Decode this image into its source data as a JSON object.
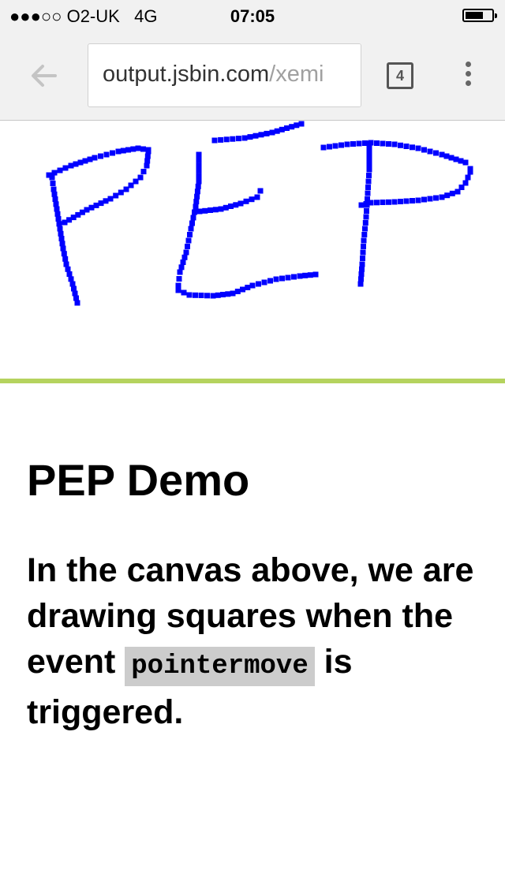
{
  "status_bar": {
    "signal": "●●●○○",
    "carrier": "O2-UK",
    "network": "4G",
    "time": "07:05"
  },
  "browser": {
    "url_host": "output.jsbin.com",
    "url_path": "/xemi",
    "tab_count": "4"
  },
  "page": {
    "heading": "PEP Demo",
    "description_before": "In the canvas above, we are drawing squares when the event ",
    "code": "pointermove",
    "description_after": " is triggered."
  },
  "canvas": {
    "stroke_color": "#0000ff",
    "divider_color": "#b5d35e"
  }
}
